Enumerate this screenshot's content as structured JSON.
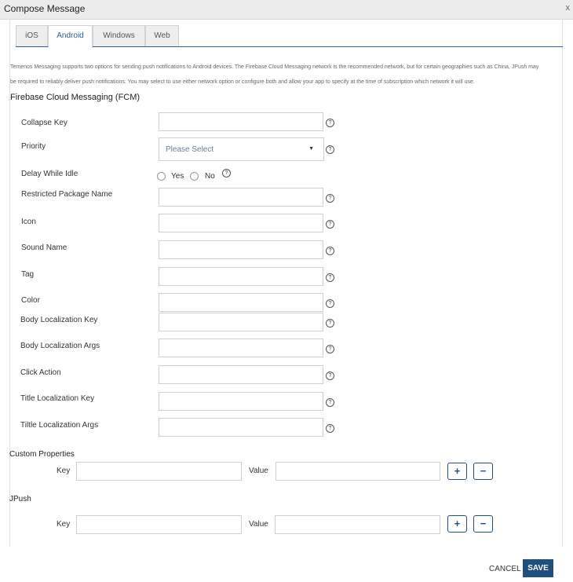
{
  "window": {
    "title": "Compose Message",
    "close": "x"
  },
  "tabs": [
    {
      "label": "iOS",
      "active": false
    },
    {
      "label": "Android",
      "active": true
    },
    {
      "label": "Windows",
      "active": false
    },
    {
      "label": "Web",
      "active": false
    }
  ],
  "intro": {
    "line1": "Temenos Messaging supports two options for sending push notifications to Android devices. The Firebase Cloud Messaging network is the recommended network, but for certain geographies such as China, JPush may",
    "line2": "be required to reliably deliver push notifications. You may select to use either network option or configure both and allow your app to specify at the time of subscription which network it will use."
  },
  "fcm": {
    "title": "Firebase Cloud Messaging (FCM)",
    "collapse_key": "Collapse Key",
    "priority": "Priority",
    "priority_placeholder": "Please Select",
    "delay_while_idle": "Delay While Idle",
    "yes": "Yes",
    "no": "No",
    "restricted_package_name": "Restricted Package Name",
    "icon": "Icon",
    "sound_name": "Sound Name",
    "tag": "Tag",
    "color": "Color",
    "body_loc_key": "Body Localization Key",
    "body_loc_args": "Body Localization Args",
    "click_action": "Click Action",
    "title_loc_key": "Title Localization Key",
    "title_loc_args": "Tiltle Localization Args",
    "help": "?"
  },
  "custom": {
    "title": "Custom Properties",
    "key": "Key",
    "value": "Value"
  },
  "jpush": {
    "title": "JPush",
    "key": "Key",
    "value": "Value"
  },
  "buttons": {
    "add": "+",
    "remove": "−",
    "cancel": "CANCEL",
    "save": "SAVE"
  },
  "colors": {
    "accent": "#1f4f7f",
    "tab_active_text": "#2a5c8a"
  }
}
